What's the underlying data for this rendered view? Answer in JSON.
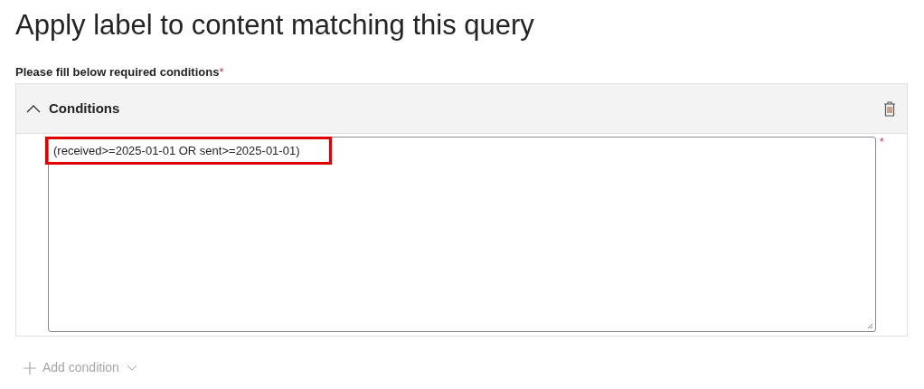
{
  "title": "Apply label to content matching this query",
  "required_label": {
    "text": "Please fill below required conditions",
    "required_mark": "*"
  },
  "conditions": {
    "title": "Conditions",
    "expanded": true,
    "query": {
      "value": "(received>=2025-01-01 OR sent>=2025-01-01)",
      "highlighted": true,
      "required_mark": "*"
    }
  },
  "add_condition": {
    "label": "Add condition",
    "disabled": true
  }
}
